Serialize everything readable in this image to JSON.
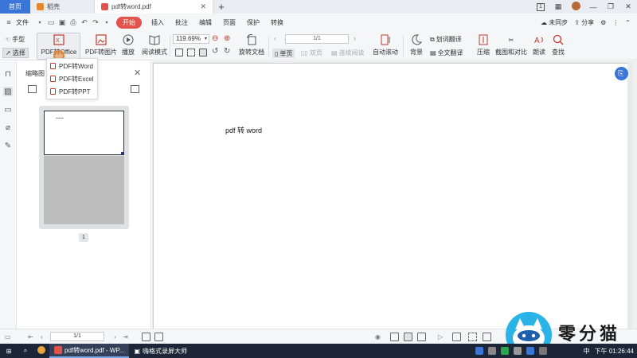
{
  "titlebar": {
    "tabs": [
      {
        "label": "首页"
      },
      {
        "label": "稻壳"
      },
      {
        "label": "pdf转word.pdf"
      }
    ],
    "badge_count": "1"
  },
  "menubar": {
    "file_label": "文件",
    "items": [
      "开始",
      "插入",
      "批注",
      "编辑",
      "页面",
      "保护",
      "转换"
    ],
    "sync_label": "未同步",
    "share_label": "分享"
  },
  "toolbar": {
    "hand_label": "手型",
    "select_label": "选择",
    "pdf_office_label": "PDF转Office",
    "pdf_image_label": "PDF转图片",
    "play_label": "播放",
    "read_mode_label": "阅读模式",
    "zoom_value": "119.69%",
    "rotate_label": "旋转文档",
    "single_label": "单页",
    "double_label": "双页",
    "continuous_label": "连续阅读",
    "page_value": "1",
    "page_total": "/1",
    "autoscroll_label": "自动滚动",
    "background_label": "背景",
    "translate_label": "划词翻译",
    "full_translate_label": "全文翻译",
    "compress_label": "压缩",
    "screenshot_label": "截图和对比",
    "read_aloud_label": "朗读",
    "find_label": "查找"
  },
  "dropdown": {
    "items": [
      "PDF转Word",
      "PDF转Excel",
      "PDF转PPT"
    ]
  },
  "thumbpanel": {
    "title": "缩略图",
    "page_number": "1",
    "thumb_text": "....."
  },
  "document": {
    "body_text": "pdf 转 word"
  },
  "statusbar": {
    "page_value": "1/1"
  },
  "watermark": {
    "text": "零分猫"
  },
  "taskbar": {
    "apps": [
      {
        "label": "pdf转word.pdf - WP..."
      },
      {
        "label": "嗨格式录屏大师"
      }
    ],
    "ime": "中",
    "clock": "下午 01:26:44"
  },
  "colors": {
    "accent": "#3a75d8",
    "active_tab": "#e2544b",
    "taskbar": "#1d2638",
    "watermark": "#2bb3e8"
  }
}
